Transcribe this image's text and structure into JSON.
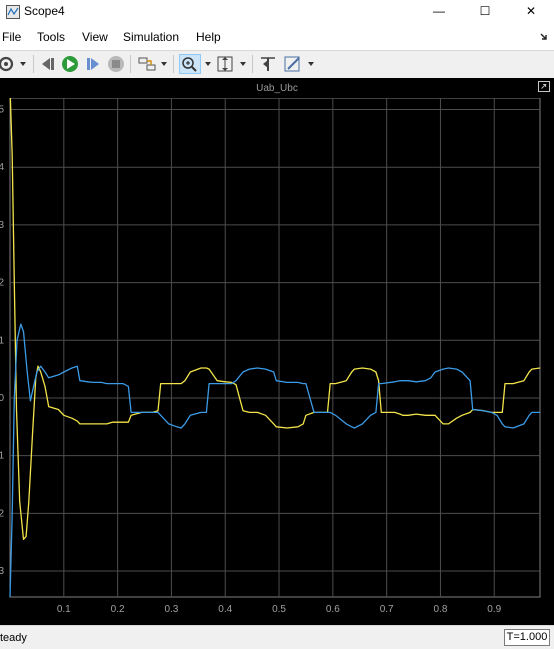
{
  "window": {
    "title": "Scope4"
  },
  "window_buttons": {
    "minimize": "—",
    "maximize": "☐",
    "close": "✕"
  },
  "menu": [
    "File",
    "Tools",
    "View",
    "Simulation",
    "Help"
  ],
  "toolbar": [
    "settings-icon",
    "step-back-icon",
    "run-icon",
    "step-forward-icon",
    "stop-icon",
    "signal-select-icon",
    "zoom-icon",
    "scale-axes-icon",
    "cursor-icon",
    "highlight-icon"
  ],
  "scope": {
    "title": "Uab_Ubc"
  },
  "status": {
    "text": "teady",
    "time": "T=1.000"
  },
  "chart_data": {
    "type": "line",
    "title": "Uab_Ubc",
    "xlim": [
      0,
      0.985
    ],
    "ylim": [
      -3.45,
      5.2
    ],
    "x_ticks": [
      0.1,
      0.2,
      0.3,
      0.4,
      0.5,
      0.6,
      0.7,
      0.8,
      0.9
    ],
    "x_tick_labels": [
      "0.1",
      "0.2",
      "0.3",
      "0.4",
      "0.5",
      "0.6",
      "0.7",
      "0.8",
      "0.9"
    ],
    "y_ticks": [
      5,
      4,
      3,
      2,
      1,
      0,
      -1,
      -2,
      -3
    ],
    "y_tick_labels": [
      "5",
      "4",
      "3",
      "2",
      "1",
      "0",
      "1",
      "2",
      "3"
    ],
    "grid": true,
    "colors": {
      "background": "#000000",
      "grid": "#4d4d4d",
      "ticks": "#a0a0a0"
    },
    "series": [
      {
        "color": "#f2e44a",
        "x": [
          0,
          0.004,
          0.008,
          0.012,
          0.018,
          0.025,
          0.03,
          0.035,
          0.042,
          0.048,
          0.052,
          0.057,
          0.065,
          0.072,
          0.09,
          0.1,
          0.115,
          0.125,
          0.13,
          0.145,
          0.155,
          0.17,
          0.18,
          0.19,
          0.21,
          0.22,
          0.225,
          0.245,
          0.265,
          0.275,
          0.28,
          0.295,
          0.31,
          0.318,
          0.325,
          0.335,
          0.355,
          0.365,
          0.37,
          0.385,
          0.4,
          0.412,
          0.42,
          0.433,
          0.445,
          0.46,
          0.475,
          0.49,
          0.495,
          0.515,
          0.535,
          0.545,
          0.55,
          0.565,
          0.58,
          0.59,
          0.595,
          0.605,
          0.625,
          0.635,
          0.64,
          0.655,
          0.67,
          0.68,
          0.685,
          0.69,
          0.715,
          0.725,
          0.73,
          0.74,
          0.755,
          0.772,
          0.782,
          0.79,
          0.805,
          0.815,
          0.83,
          0.84,
          0.855,
          0.86,
          0.88,
          0.895,
          0.905,
          0.915,
          0.92,
          0.935,
          0.955,
          0.965,
          0.97,
          0.985
        ],
        "y": [
          5.4,
          4.2,
          2.0,
          -0.2,
          -1.8,
          -2.45,
          -2.4,
          -1.8,
          -0.6,
          0.35,
          0.55,
          0.45,
          0.2,
          -0.15,
          -0.2,
          -0.3,
          -0.35,
          -0.4,
          -0.45,
          -0.45,
          -0.45,
          -0.45,
          -0.45,
          -0.42,
          -0.42,
          -0.42,
          -0.3,
          -0.25,
          -0.25,
          -0.22,
          0.25,
          0.25,
          0.25,
          0.25,
          0.3,
          0.45,
          0.52,
          0.52,
          0.5,
          0.3,
          0.28,
          0.27,
          0.23,
          -0.22,
          -0.25,
          -0.25,
          -0.3,
          -0.45,
          -0.5,
          -0.52,
          -0.5,
          -0.45,
          -0.3,
          -0.25,
          -0.25,
          -0.25,
          0.25,
          0.25,
          0.3,
          0.45,
          0.5,
          0.52,
          0.5,
          0.45,
          0.3,
          -0.25,
          -0.25,
          -0.28,
          -0.3,
          -0.3,
          -0.28,
          -0.3,
          -0.3,
          -0.3,
          -0.45,
          -0.45,
          -0.35,
          -0.3,
          -0.25,
          -0.2,
          -0.22,
          -0.25,
          -0.25,
          -0.25,
          0.25,
          0.25,
          0.3,
          0.45,
          0.5,
          0.52
        ]
      },
      {
        "color": "#3c9be6",
        "x": [
          0,
          0.004,
          0.008,
          0.013,
          0.02,
          0.025,
          0.032,
          0.038,
          0.045,
          0.05,
          0.057,
          0.065,
          0.072,
          0.09,
          0.1,
          0.115,
          0.125,
          0.13,
          0.145,
          0.155,
          0.17,
          0.18,
          0.19,
          0.21,
          0.22,
          0.225,
          0.245,
          0.265,
          0.275,
          0.28,
          0.295,
          0.31,
          0.318,
          0.325,
          0.335,
          0.355,
          0.365,
          0.37,
          0.385,
          0.4,
          0.412,
          0.42,
          0.433,
          0.445,
          0.46,
          0.475,
          0.49,
          0.495,
          0.515,
          0.535,
          0.545,
          0.55,
          0.565,
          0.58,
          0.59,
          0.595,
          0.605,
          0.625,
          0.635,
          0.64,
          0.655,
          0.67,
          0.68,
          0.685,
          0.69,
          0.715,
          0.725,
          0.73,
          0.74,
          0.755,
          0.772,
          0.782,
          0.79,
          0.805,
          0.815,
          0.83,
          0.84,
          0.855,
          0.86,
          0.88,
          0.895,
          0.905,
          0.915,
          0.92,
          0.935,
          0.955,
          0.965,
          0.97,
          0.985
        ],
        "y": [
          -3.45,
          -2.0,
          0.0,
          1.0,
          1.28,
          1.15,
          0.45,
          -0.05,
          0.25,
          0.45,
          0.55,
          0.45,
          0.35,
          0.4,
          0.45,
          0.52,
          0.55,
          0.3,
          0.28,
          0.27,
          0.27,
          0.25,
          0.25,
          0.25,
          0.2,
          -0.25,
          -0.25,
          -0.25,
          -0.25,
          -0.3,
          -0.45,
          -0.5,
          -0.52,
          -0.45,
          -0.3,
          -0.25,
          -0.25,
          0.25,
          0.25,
          0.25,
          0.25,
          0.3,
          0.45,
          0.5,
          0.52,
          0.5,
          0.45,
          0.3,
          0.27,
          0.27,
          0.25,
          0.25,
          -0.25,
          -0.25,
          -0.25,
          -0.25,
          -0.3,
          -0.45,
          -0.5,
          -0.52,
          -0.45,
          -0.3,
          -0.25,
          0.25,
          0.25,
          0.28,
          0.3,
          0.3,
          0.3,
          0.28,
          0.3,
          0.35,
          0.45,
          0.5,
          0.52,
          0.5,
          0.45,
          0.3,
          -0.2,
          -0.22,
          -0.25,
          -0.3,
          -0.45,
          -0.5,
          -0.52,
          -0.45,
          -0.3,
          -0.25,
          -0.25
        ]
      }
    ]
  }
}
